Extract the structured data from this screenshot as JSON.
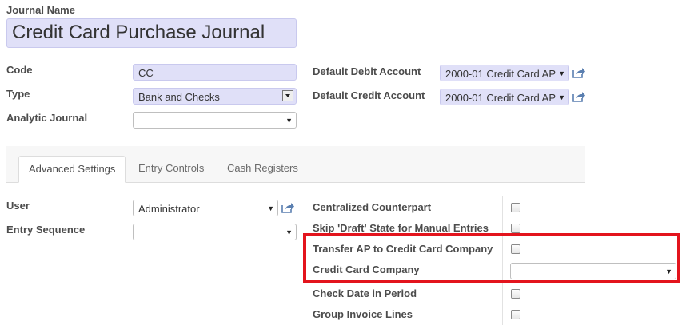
{
  "journal_name": {
    "label": "Journal Name",
    "value": "Credit Card Purchase Journal"
  },
  "left_fields": {
    "code_label": "Code",
    "code_value": "CC",
    "type_label": "Type",
    "type_value": "Bank and Checks",
    "analytic_label": "Analytic Journal",
    "analytic_value": ""
  },
  "right_fields": {
    "debit_label": "Default Debit Account",
    "debit_value": "2000-01 Credit Card AP",
    "credit_label": "Default Credit Account",
    "credit_value": "2000-01 Credit Card AP"
  },
  "tabs": [
    {
      "label": "Advanced Settings",
      "active": true
    },
    {
      "label": "Entry Controls",
      "active": false
    },
    {
      "label": "Cash Registers",
      "active": false
    }
  ],
  "settings_left": {
    "user_label": "User",
    "user_value": "Administrator",
    "sequence_label": "Entry Sequence",
    "sequence_value": ""
  },
  "settings_right": {
    "centralized_label": "Centralized Counterpart",
    "skip_draft_label": "Skip 'Draft' State for Manual Entries",
    "transfer_ap_label": "Transfer AP to Credit Card Company",
    "cc_company_label": "Credit Card Company",
    "cc_company_value": "",
    "check_date_label": "Check Date in Period",
    "group_invoice_label": "Group Invoice Lines"
  },
  "colors": {
    "required_field": "#e0e0f8",
    "highlight_border": "#e3141d",
    "link_icon": "#5a7fb0"
  }
}
